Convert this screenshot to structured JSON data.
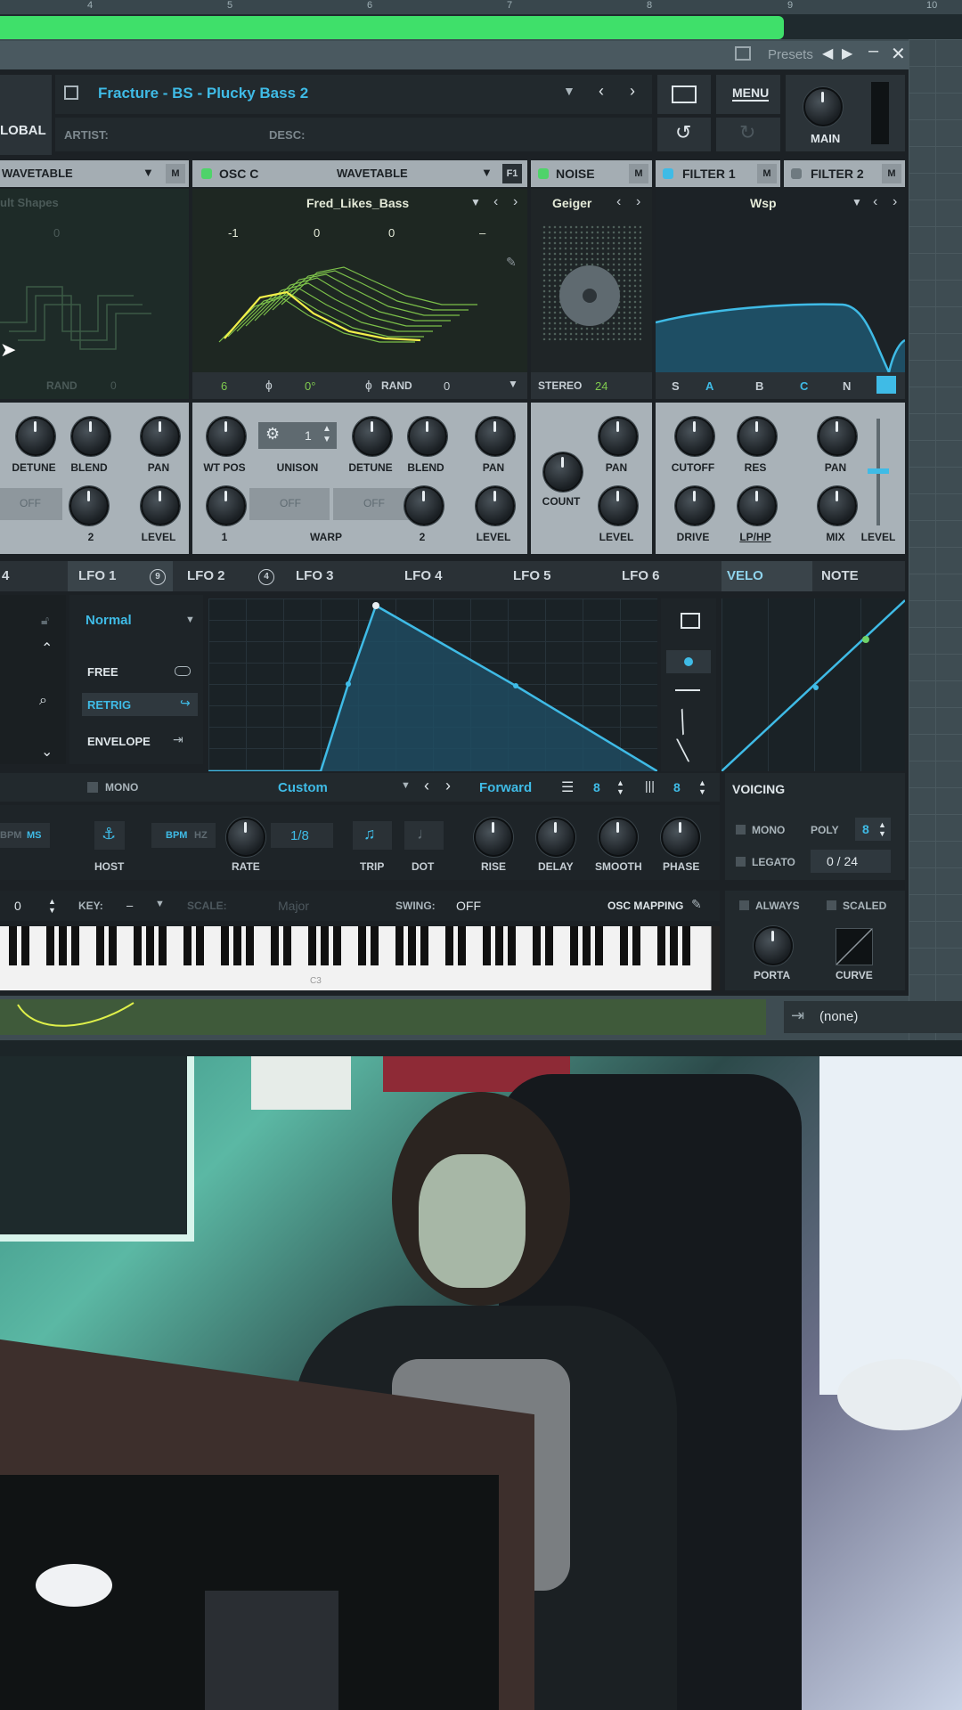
{
  "timeline": {
    "markers": [
      "4",
      "5",
      "6",
      "7",
      "8",
      "9",
      "10"
    ]
  },
  "window": {
    "presets_label": "Presets",
    "global_tab": "LOBAL",
    "preset_name": "Fracture - BS - Plucky Bass 2",
    "artist_label": "ARTIST:",
    "desc_label": "DESC:",
    "menu_label": "MENU",
    "main_label": "MAIN"
  },
  "osc_b": {
    "type": "WAVETABLE",
    "m": "M",
    "wave_name": "ult Shapes",
    "zeros": [
      "0"
    ],
    "rand_label": "RAND",
    "rand_val": "0",
    "knobs": [
      "DETUNE",
      "BLEND",
      "PAN",
      "LEVEL"
    ],
    "off": "OFF",
    "warp_val": "2"
  },
  "osc_c": {
    "label": "OSC C",
    "type": "WAVETABLE",
    "f1": "F1",
    "wave_name": "Fred_Likes_Bass",
    "params": [
      "-1",
      "0",
      "0",
      "–"
    ],
    "oct": "6",
    "phase": "0°",
    "rand_label": "RAND",
    "rand_val": "0",
    "knobs": {
      "wtpos": "WT POS",
      "unison": "UNISON",
      "unison_val": "1",
      "detune": "DETUNE",
      "blend": "BLEND",
      "pan": "PAN",
      "level": "LEVEL",
      "warp": "WARP",
      "off1": "OFF",
      "off2": "OFF",
      "w1": "1",
      "w2": "2"
    }
  },
  "noise": {
    "label": "NOISE",
    "m": "M",
    "name": "Geiger",
    "stereo": "STEREO",
    "stereo_val": "24",
    "knobs": {
      "count": "COUNT",
      "pan": "PAN",
      "level": "LEVEL"
    }
  },
  "filter1": {
    "label": "FILTER 1",
    "m": "M",
    "type": "Wsp",
    "routes": [
      "S",
      "A",
      "B",
      "C",
      "N"
    ],
    "knobs": {
      "cutoff": "CUTOFF",
      "res": "RES",
      "pan": "PAN",
      "drive": "DRIVE",
      "lphp": "LP/HP",
      "mix": "MIX",
      "level": "LEVEL"
    }
  },
  "filter2": {
    "label": "FILTER 2",
    "m": "M"
  },
  "mod_tabs": {
    "first": "4",
    "lfo1": "LFO 1",
    "lfo1_count": "9",
    "lfo2": "LFO 2",
    "lfo2_count": "4",
    "lfo3": "LFO 3",
    "lfo4": "LFO 4",
    "lfo5": "LFO 5",
    "lfo6": "LFO 6",
    "velo": "VELO",
    "note": "NOTE"
  },
  "lfo": {
    "mode": "Normal",
    "free": "FREE",
    "retrig": "RETRIG",
    "envelope": "ENVELOPE",
    "mono": "MONO",
    "shape": "Custom",
    "direction": "Forward",
    "grid1": "8",
    "grid2": "8",
    "host": "HOST",
    "bpm": "BPM",
    "hz": "HZ",
    "rate": "RATE",
    "rate_val": "1/8",
    "trip": "TRIP",
    "dot": "DOT",
    "rise": "RISE",
    "delay": "DELAY",
    "smooth": "SMOOTH",
    "phase": "PHASE",
    "left_bpm": "BPM",
    "left_ms": "MS",
    "side_label": "3 s"
  },
  "voicing": {
    "title": "VOICING",
    "mono": "MONO",
    "poly": "POLY",
    "poly_val": "8",
    "legato": "LEGATO",
    "voices": "0 / 24"
  },
  "bottom": {
    "oct_val": "0",
    "key_label": "KEY:",
    "key_val": "–",
    "scale_label": "SCALE:",
    "scale_val": "Major",
    "swing_label": "SWING:",
    "swing_val": "OFF",
    "osc_mapping": "OSC MAPPING",
    "always": "ALWAYS",
    "scaled": "SCALED",
    "porta": "PORTA",
    "curve": "CURVE",
    "c3": "C3"
  },
  "automation": {
    "none_label": "(none)"
  },
  "colors": {
    "accent": "#3fbbe6",
    "green_bar": "#3fe06a",
    "led": "#4fd36a"
  },
  "icons": [
    "save-icon",
    "dropdown-icon",
    "prev-icon",
    "next-icon",
    "browser-icon",
    "undo-icon",
    "redo-icon",
    "close-icon",
    "minimize-icon",
    "anchor-icon",
    "note-icon",
    "search-icon",
    "lock-icon",
    "link-icon"
  ]
}
